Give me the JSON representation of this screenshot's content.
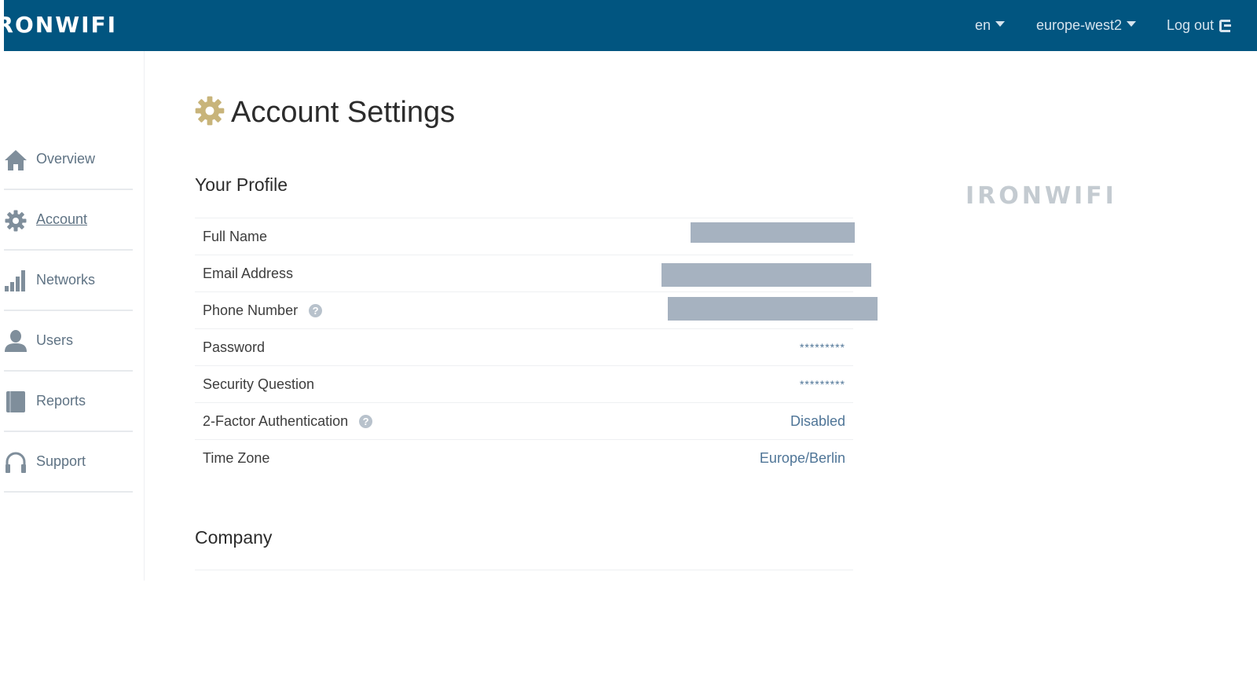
{
  "header": {
    "logo": "IRONWIFI",
    "visible_logo_text": "RONWIFI",
    "language": "en",
    "region": "europe-west2",
    "logout_label": "Log out",
    "background_color": "#015580"
  },
  "sidebar": {
    "items": [
      {
        "label": "Overview",
        "icon": "home-icon"
      },
      {
        "label": "Account",
        "icon": "gear-icon",
        "active": true
      },
      {
        "label": "Networks",
        "icon": "signal-bars-icon"
      },
      {
        "label": "Users",
        "icon": "user-icon"
      },
      {
        "label": "Reports",
        "icon": "book-icon"
      },
      {
        "label": "Support",
        "icon": "headphones-icon"
      }
    ]
  },
  "page": {
    "title": "Account Settings",
    "title_icon": "gear-icon",
    "title_icon_color": "#c8b47a"
  },
  "profile": {
    "heading": "Your Profile",
    "rows": [
      {
        "label": "Full Name",
        "value": "",
        "redacted": true
      },
      {
        "label": "Email Address",
        "value": "",
        "redacted": true
      },
      {
        "label": "Phone Number",
        "value": "",
        "redacted": true,
        "help": true
      },
      {
        "label": "Password",
        "value": "*********"
      },
      {
        "label": "Security Question",
        "value": "*********"
      },
      {
        "label": "2-Factor Authentication",
        "value": "Disabled",
        "help": true
      },
      {
        "label": "Time Zone",
        "value": "Europe/Berlin"
      }
    ]
  },
  "company": {
    "heading": "Company"
  },
  "watermark": {
    "text": "IRONWIFI"
  }
}
